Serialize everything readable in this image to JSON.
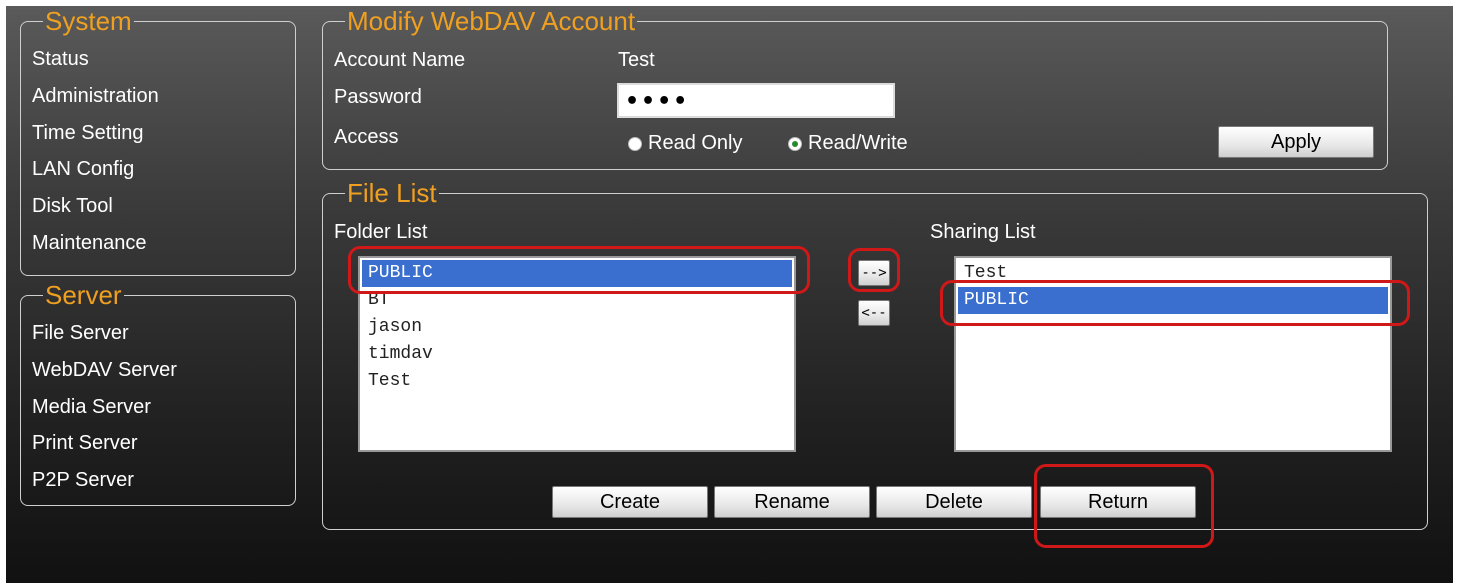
{
  "system_panel": {
    "title": "System",
    "items": [
      "Status",
      "Administration",
      "Time Setting",
      "LAN Config",
      "Disk Tool",
      "Maintenance"
    ]
  },
  "server_panel": {
    "title": "Server",
    "items": [
      "File Server",
      "WebDAV Server",
      "Media Server",
      "Print Server",
      "P2P Server"
    ]
  },
  "account_panel": {
    "title": "Modify WebDAV Account",
    "account_name_label": "Account Name",
    "account_name_value": "Test",
    "password_label": "Password",
    "password_value": "••••",
    "access_label": "Access",
    "access_options": [
      {
        "label": "Read Only",
        "selected": false
      },
      {
        "label": "Read/Write",
        "selected": true
      }
    ],
    "apply_label": "Apply"
  },
  "file_list_panel": {
    "title": "File List",
    "folder_list_label": "Folder List",
    "folder_list": [
      "PUBLIC",
      "BT",
      "jason",
      "timdav",
      "Test"
    ],
    "folder_selected": "PUBLIC",
    "sharing_list_label": "Sharing List",
    "sharing_list": [
      "Test",
      "PUBLIC"
    ],
    "sharing_selected": "PUBLIC",
    "add_arrow_label": "-->",
    "remove_arrow_label": "<--",
    "buttons": {
      "create": "Create",
      "rename": "Rename",
      "delete": "Delete",
      "return": "Return"
    }
  },
  "colors": {
    "accent": "#f0a020",
    "selection": "#3a6fd0",
    "annotation": "#d01818"
  }
}
